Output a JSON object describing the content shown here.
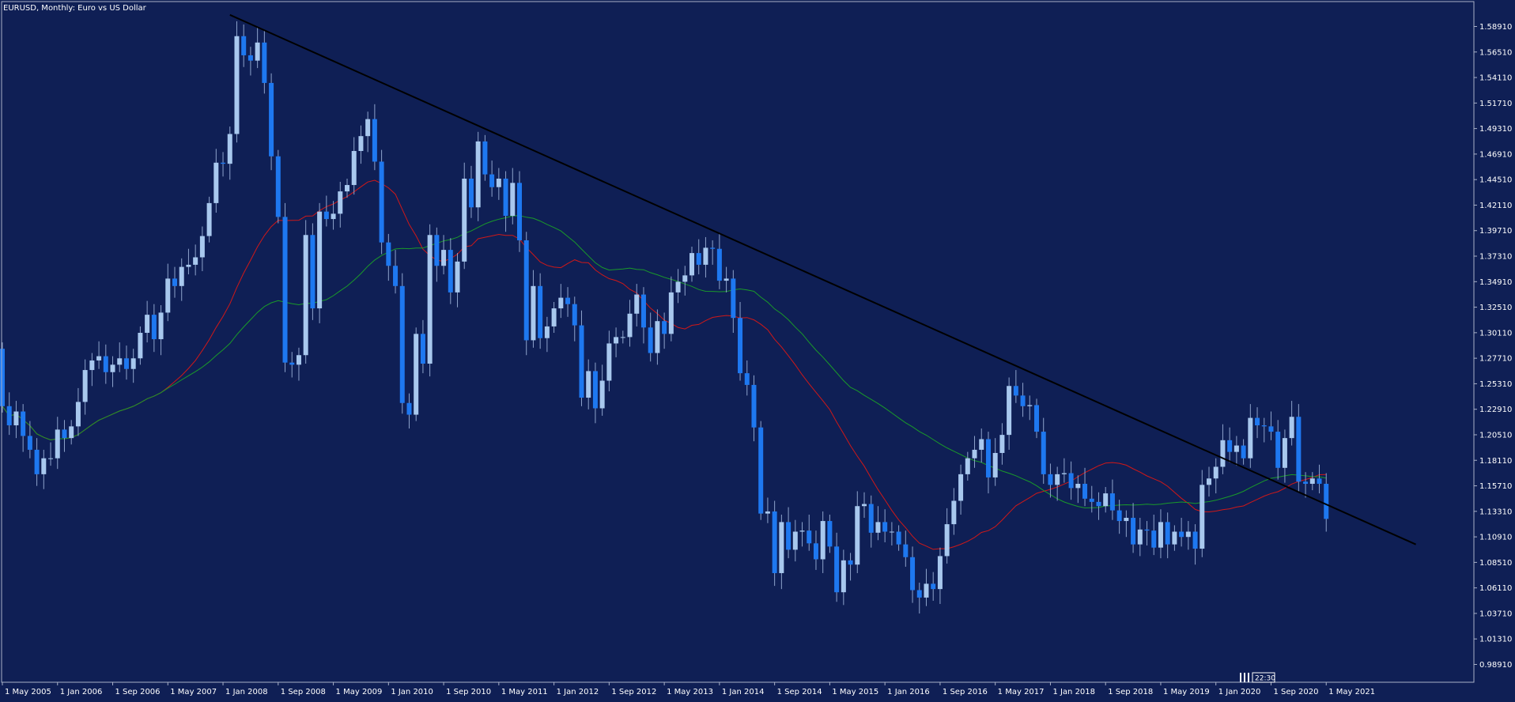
{
  "window": {
    "title": "EURUSD, Monthly:  Euro vs US Dollar",
    "time_badge": "22:30"
  },
  "colors": {
    "background": "#0f1f55",
    "frame": "#a8b0c8",
    "bull_body": "#a8c8ee",
    "bear_body": "#1e78f0",
    "wick": "#8ea3cc",
    "ma_fast": "#d01818",
    "ma_slow": "#1a9a2a",
    "trendline": "#000000",
    "text": "#ffffff"
  },
  "chart_data": {
    "type": "candlestick",
    "title": "EURUSD, Monthly:  Euro vs US Dollar",
    "grid": false,
    "y_axis_position": "right",
    "ylim": [
      0.97,
      1.61
    ],
    "y_ticks": [
      "1.58910",
      "1.56510",
      "1.54110",
      "1.51710",
      "1.49310",
      "1.46910",
      "1.44510",
      "1.42110",
      "1.39710",
      "1.37310",
      "1.34910",
      "1.32510",
      "1.30110",
      "1.27710",
      "1.25310",
      "1.22910",
      "1.20510",
      "1.18110",
      "1.15710",
      "1.13310",
      "1.10910",
      "1.08510",
      "1.06110",
      "1.03710",
      "1.01310",
      "0.98910"
    ],
    "x_ticks": [
      {
        "label": "1 May 2005",
        "index": 0
      },
      {
        "label": "1 Jan 2006",
        "index": 8
      },
      {
        "label": "1 Sep 2006",
        "index": 16
      },
      {
        "label": "1 May 2007",
        "index": 24
      },
      {
        "label": "1 Jan 2008",
        "index": 32
      },
      {
        "label": "1 Sep 2008",
        "index": 40
      },
      {
        "label": "1 May 2009",
        "index": 48
      },
      {
        "label": "1 Jan 2010",
        "index": 56
      },
      {
        "label": "1 Sep 2010",
        "index": 64
      },
      {
        "label": "1 May 2011",
        "index": 72
      },
      {
        "label": "1 Jan 2012",
        "index": 80
      },
      {
        "label": "1 Sep 2012",
        "index": 88
      },
      {
        "label": "1 May 2013",
        "index": 96
      },
      {
        "label": "1 Jan 2014",
        "index": 104
      },
      {
        "label": "1 Sep 2014",
        "index": 112
      },
      {
        "label": "1 May 2015",
        "index": 120
      },
      {
        "label": "1 Jan 2016",
        "index": 128
      },
      {
        "label": "1 Sep 2016",
        "index": 136
      },
      {
        "label": "1 May 2017",
        "index": 144
      },
      {
        "label": "1 Jan 2018",
        "index": 152
      },
      {
        "label": "1 Sep 2018",
        "index": 160
      },
      {
        "label": "1 May 2019",
        "index": 168
      },
      {
        "label": "1 Jan 2020",
        "index": 176
      },
      {
        "label": "1 Sep 2020",
        "index": 184
      },
      {
        "label": "1 May 2021",
        "index": 192
      }
    ],
    "closes": [
      1.232,
      1.214,
      1.227,
      1.204,
      1.191,
      1.168,
      1.183,
      1.183,
      1.21,
      1.202,
      1.213,
      1.236,
      1.266,
      1.275,
      1.279,
      1.264,
      1.271,
      1.277,
      1.267,
      1.277,
      1.301,
      1.318,
      1.295,
      1.32,
      1.352,
      1.345,
      1.363,
      1.365,
      1.372,
      1.392,
      1.423,
      1.461,
      1.46,
      1.488,
      1.58,
      1.562,
      1.557,
      1.574,
      1.536,
      1.467,
      1.41,
      1.273,
      1.271,
      1.28,
      1.393,
      1.324,
      1.415,
      1.408,
      1.413,
      1.434,
      1.44,
      1.472,
      1.486,
      1.502,
      1.462,
      1.386,
      1.364,
      1.345,
      1.235,
      1.224,
      1.3,
      1.272,
      1.393,
      1.364,
      1.379,
      1.339,
      1.368,
      1.446,
      1.419,
      1.481,
      1.45,
      1.438,
      1.446,
      1.411,
      1.442,
      1.388,
      1.294,
      1.345,
      1.296,
      1.307,
      1.324,
      1.334,
      1.328,
      1.308,
      1.24,
      1.265,
      1.23,
      1.256,
      1.291,
      1.297,
      1.297,
      1.319,
      1.337,
      1.306,
      1.282,
      1.312,
      1.3,
      1.339,
      1.349,
      1.355,
      1.376,
      1.365,
      1.381,
      1.38,
      1.35,
      1.352,
      1.315,
      1.263,
      1.252,
      1.212,
      1.131,
      1.133,
      1.075,
      1.123,
      1.097,
      1.114,
      1.115,
      1.103,
      1.088,
      1.124,
      1.1,
      1.057,
      1.087,
      1.083,
      1.138,
      1.14,
      1.113,
      1.123,
      1.114,
      1.114,
      1.102,
      1.09,
      1.059,
      1.052,
      1.065,
      1.06,
      1.091,
      1.121,
      1.143,
      1.168,
      1.183,
      1.191,
      1.201,
      1.165,
      1.188,
      1.205,
      1.251,
      1.242,
      1.232,
      1.233,
      1.208,
      1.168,
      1.158,
      1.168,
      1.169,
      1.155,
      1.159,
      1.145,
      1.142,
      1.138,
      1.15,
      1.134,
      1.124,
      1.127,
      1.102,
      1.116,
      1.115,
      1.099,
      1.123,
      1.102,
      1.114,
      1.109,
      1.114,
      1.098,
      1.158,
      1.164,
      1.175,
      1.2,
      1.189,
      1.195,
      1.183,
      1.221,
      1.214,
      1.213,
      1.208,
      1.174,
      1.202,
      1.222,
      1.161,
      1.159,
      1.164,
      1.159,
      1.126
    ],
    "opens_first": 1.286,
    "highs_lows_pad": 0.012,
    "ma_fast_label": "",
    "ma_slow_label": "",
    "trendline": {
      "from": {
        "index": 33,
        "price": 1.6
      },
      "to": {
        "index": 205,
        "price": 1.102
      }
    }
  }
}
